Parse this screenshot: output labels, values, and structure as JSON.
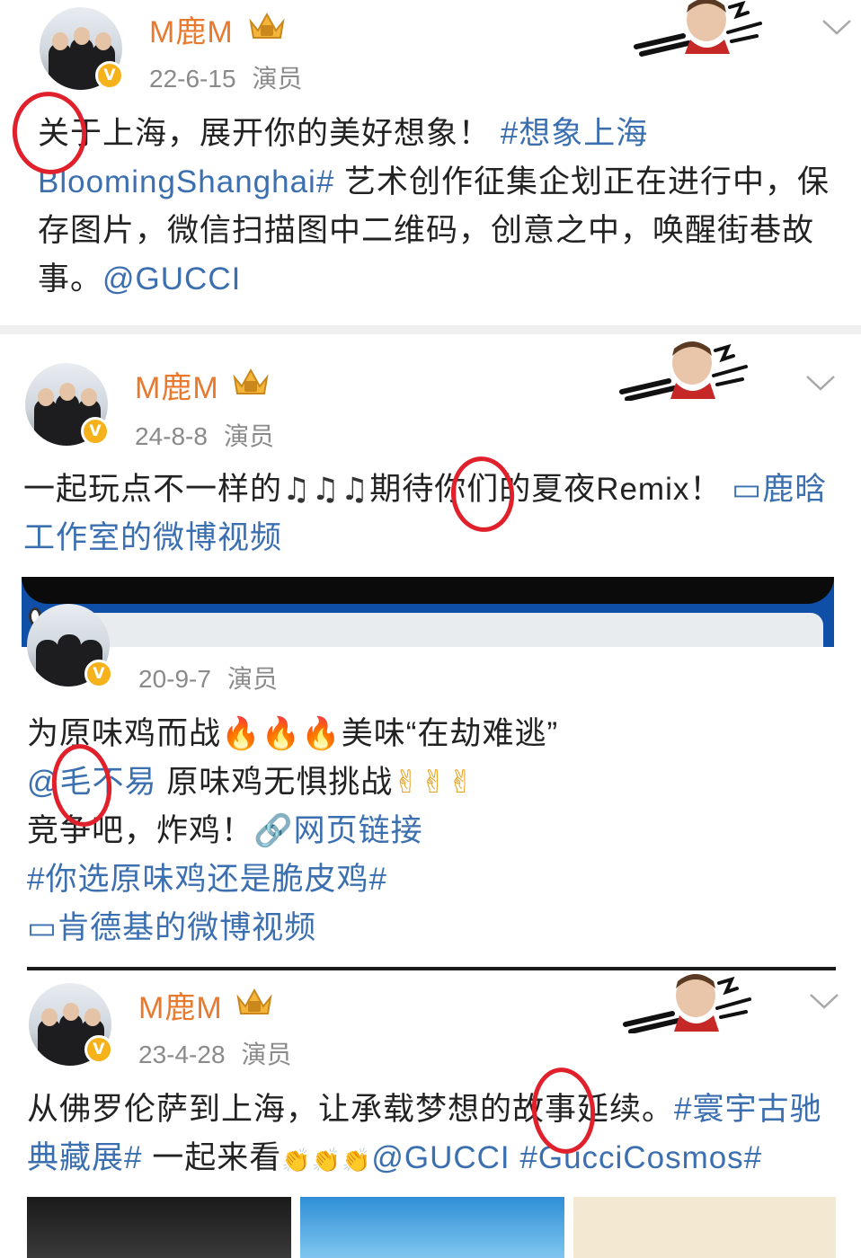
{
  "posts": [
    {
      "author": "M鹿M",
      "date": "22-6-15",
      "role": "演员",
      "text_parts": [
        "关于上海，展开你的美好想象！",
        "#想象上海",
        "BloomingShanghai#",
        "艺术创作征集企划正在进行中，保",
        "存图片，微信扫描图中二维码，创意之中，唤醒街巷故",
        "事。",
        "@GUCCI"
      ]
    },
    {
      "author": "M鹿M",
      "date": "24-8-8",
      "role": "演员",
      "text_a": "一起玩点不一样的",
      "text_b": "期待你们的夏夜Remix！",
      "video_link": "鹿晗工作室的微博视频"
    },
    {
      "date": "20-9-7",
      "role": "演员",
      "line1_a": "为原味鸡而战",
      "line1_b": "美味“在劫难逃”",
      "line2_mention": "@毛不易",
      "line2_text": "原味鸡无惧挑战",
      "line3_text": "竞争吧，炸鸡！",
      "web_link": "网页链接",
      "hashtag": "#你选原味鸡还是脆皮鸡#",
      "video_link": "肯德基的微博视频"
    },
    {
      "author": "M鹿M",
      "date": "23-4-28",
      "role": "演员",
      "text_a": "从佛罗伦萨到上海，让承载梦想的故事延续。",
      "hashtag1": "#寰宇古驰",
      "hashtag1b": "典藏展#",
      "text_b": "一起来看",
      "mention": "@GUCCI",
      "hashtag2": "#GucciCosmos#"
    }
  ],
  "icons": {
    "note": "♫",
    "fire": "🔥",
    "victory": "✌",
    "clap": "👏",
    "video": "▭",
    "link": "🔗"
  },
  "colors": {
    "author": "#e8792d",
    "link": "#3b6fb0",
    "circle": "#e0202a"
  }
}
